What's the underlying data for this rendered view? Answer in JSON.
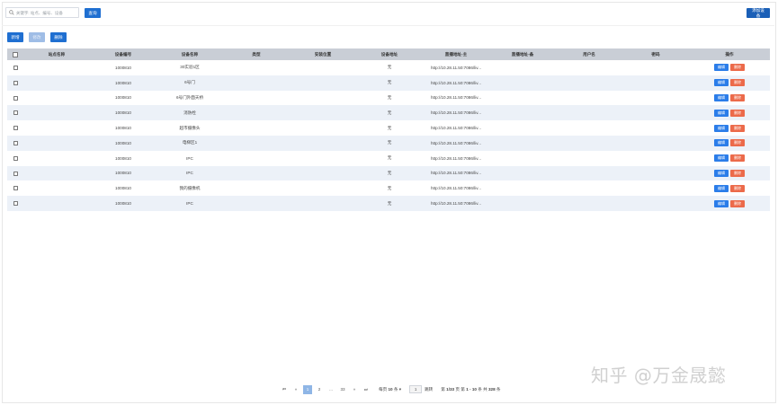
{
  "toolbar": {
    "search_placeholder": "关键字: 站点、编号、设备",
    "search_button": "查询",
    "add_device_button": "添加设备"
  },
  "actions": {
    "add": "新增",
    "edit": "修改",
    "delete": "删除"
  },
  "table": {
    "headers": [
      "站点名称",
      "设备编号",
      "设备名称",
      "类型",
      "安装位置",
      "设备地址",
      "直播地址-主",
      "直播地址-备",
      "用户名",
      "密码",
      "操作"
    ],
    "edit_label": "编辑",
    "delete_label": "删除",
    "rows": [
      {
        "site": "",
        "code": "1000810",
        "name": "30实验1区",
        "type": "",
        "location": "",
        "address": "无",
        "live_main": "http://10.28.11.50:7086/liv...",
        "live_backup": "",
        "user": "",
        "password": ""
      },
      {
        "site": "",
        "code": "1000810",
        "name": "6号门",
        "type": "",
        "location": "",
        "address": "无",
        "live_main": "http://10.28.11.50:7086/liv...",
        "live_backup": "",
        "user": "",
        "password": ""
      },
      {
        "site": "",
        "code": "1000810",
        "name": "6号门外面天桥",
        "type": "",
        "location": "",
        "address": "无",
        "live_main": "http://10.28.11.50:7086/liv...",
        "live_backup": "",
        "user": "",
        "password": ""
      },
      {
        "site": "",
        "code": "1000810",
        "name": "消防栓",
        "type": "",
        "location": "",
        "address": "无",
        "live_main": "http://10.28.11.50:7086/liv...",
        "live_backup": "",
        "user": "",
        "password": ""
      },
      {
        "site": "",
        "code": "1000810",
        "name": "超市摄像头",
        "type": "",
        "location": "",
        "address": "无",
        "live_main": "http://10.28.11.50:7086/liv...",
        "live_backup": "",
        "user": "",
        "password": ""
      },
      {
        "site": "",
        "code": "1000810",
        "name": "电梯区1",
        "type": "",
        "location": "",
        "address": "无",
        "live_main": "http://10.28.11.50:7086/liv...",
        "live_backup": "",
        "user": "",
        "password": ""
      },
      {
        "site": "",
        "code": "1000810",
        "name": "IPC",
        "type": "",
        "location": "",
        "address": "无",
        "live_main": "http://10.28.11.50:7086/liv...",
        "live_backup": "",
        "user": "",
        "password": ""
      },
      {
        "site": "",
        "code": "1000810",
        "name": "IPC",
        "type": "",
        "location": "",
        "address": "无",
        "live_main": "http://10.28.11.50:7086/liv...",
        "live_backup": "",
        "user": "",
        "password": ""
      },
      {
        "site": "",
        "code": "1000810",
        "name": "我的摄像机",
        "type": "",
        "location": "",
        "address": "无",
        "live_main": "http://10.28.11.50:7086/liv...",
        "live_backup": "",
        "user": "",
        "password": ""
      },
      {
        "site": "",
        "code": "1000810",
        "name": "IPC",
        "type": "",
        "location": "",
        "address": "无",
        "live_main": "http://10.28.11.50:7086/liv...",
        "live_backup": "",
        "user": "",
        "password": ""
      }
    ]
  },
  "pagination": {
    "first": "⏮",
    "prev": "«",
    "pages": [
      "1",
      "2",
      "...",
      "33"
    ],
    "current_page": "1",
    "next": "»",
    "last": "⏭",
    "per_page_prefix": "每页",
    "per_page_value": "10",
    "per_page_suffix": "条 ▾",
    "jump_value": "1",
    "jump_label": "跳转",
    "summary_page_prefix": "第",
    "summary_page_value": "1/33",
    "summary_page_suffix": "页",
    "summary_range_prefix": "第",
    "summary_range_value": "1 - 10",
    "summary_range_suffix": "条 共",
    "summary_total_value": "328",
    "summary_total_suffix": "条"
  },
  "watermark": "知乎 @万金晟懿",
  "colors": {
    "primary": "#1f6fd1",
    "edit": "#2b7de9",
    "delete": "#ec6a4a",
    "header_bg": "#c9ced6",
    "row_alt": "#ecf1f8"
  }
}
